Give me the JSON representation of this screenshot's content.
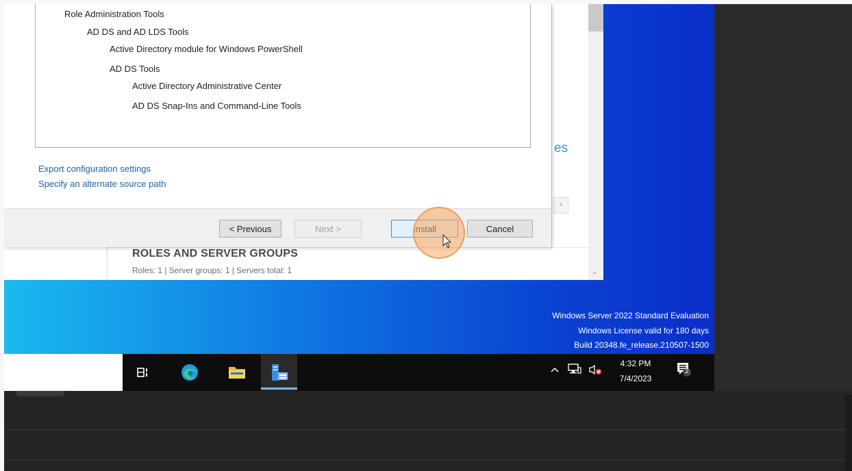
{
  "wizard": {
    "tree": [
      {
        "label": "Role Administration Tools",
        "level": 0
      },
      {
        "label": "AD DS and AD LDS Tools",
        "level": 1
      },
      {
        "label": "Active Directory module for Windows PowerShell",
        "level": 2
      },
      {
        "label": "AD DS Tools",
        "level": 2
      },
      {
        "label": "Active Directory Administrative Center",
        "level": 3
      },
      {
        "label": "AD DS Snap-Ins and Command-Line Tools",
        "level": 3
      }
    ],
    "links": {
      "export": "Export configuration settings",
      "alternate_source": "Specify an alternate source path"
    },
    "buttons": {
      "previous": "< Previous",
      "next": "Next >",
      "install": "Install",
      "cancel": "Cancel"
    }
  },
  "server_manager": {
    "partial_text": "es",
    "section_title": "ROLES AND SERVER GROUPS",
    "section_subtitle": "Roles: 1  |  Server groups: 1  |  Servers total: 1"
  },
  "watermark": {
    "line1": "Windows Server 2022 Standard Evaluation",
    "line2": "Windows License valid for 180 days",
    "line3": "Build 20348.fe_release.210507-1500"
  },
  "taskbar": {
    "icons": [
      "task-view-icon",
      "edge-icon",
      "file-explorer-icon",
      "server-manager-icon"
    ],
    "tray": {
      "time": "4:32 PM",
      "date": "7/4/2023",
      "notification_count": "2"
    }
  },
  "colors": {
    "link": "#1a63a8",
    "highlight": "#f5a564",
    "taskbar": "#0d0d0d",
    "desktop_accent": "#1596e8"
  }
}
